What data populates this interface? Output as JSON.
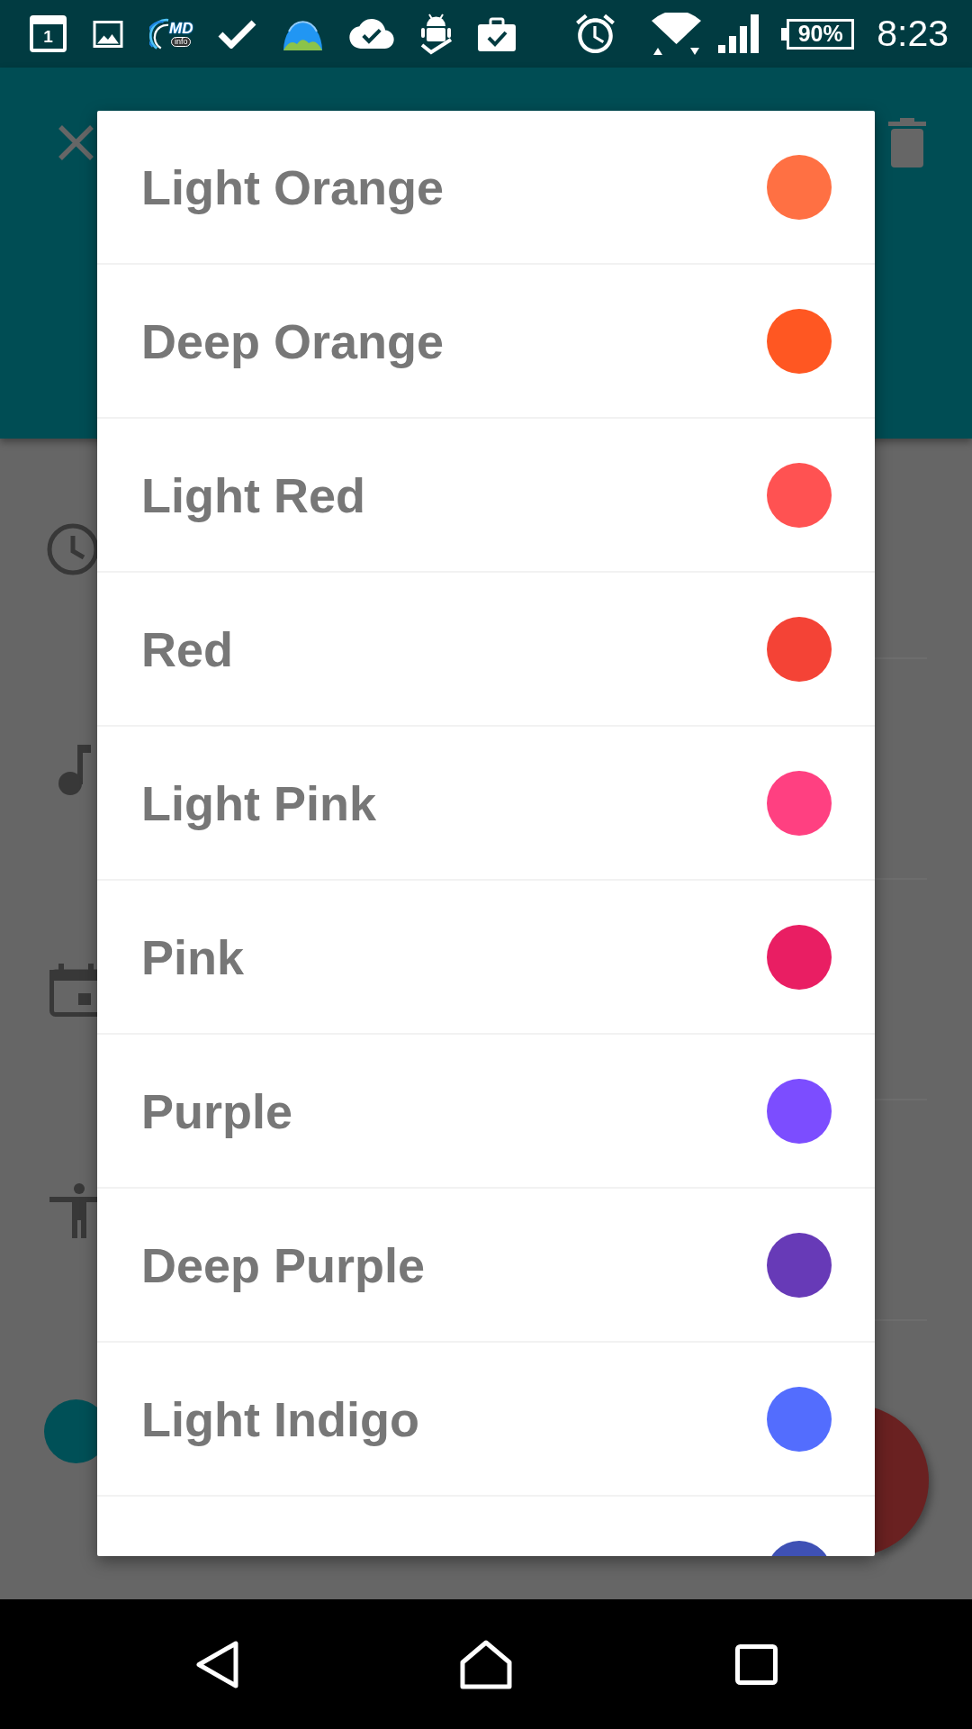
{
  "status_bar": {
    "calendar_day": "1",
    "app_logo_text": "MD",
    "app_logo_subtext": "info",
    "battery": "90%",
    "time": "8:23"
  },
  "color_dialog": {
    "options": [
      {
        "label": "Light Orange",
        "color": "#ff7043"
      },
      {
        "label": "Deep Orange",
        "color": "#ff5722"
      },
      {
        "label": "Light Red",
        "color": "#ff5252"
      },
      {
        "label": "Red",
        "color": "#f44336"
      },
      {
        "label": "Light Pink",
        "color": "#ff4081"
      },
      {
        "label": "Pink",
        "color": "#e91e63"
      },
      {
        "label": "Purple",
        "color": "#7c4dff"
      },
      {
        "label": "Deep Purple",
        "color": "#673ab7"
      },
      {
        "label": "Light Indigo",
        "color": "#536dfe"
      },
      {
        "color": "#3f51b5"
      }
    ]
  }
}
